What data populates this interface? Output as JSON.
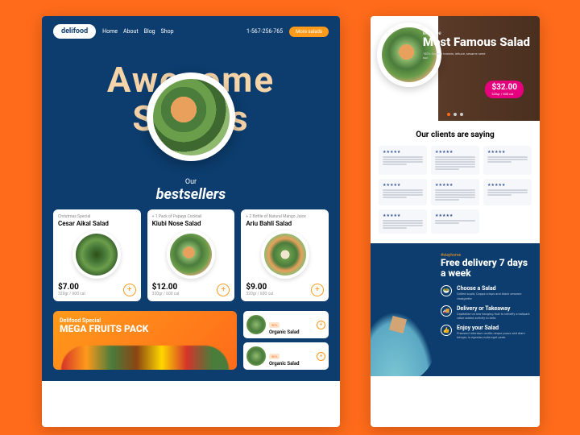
{
  "brand": "delifood",
  "nav": {
    "home": "Home",
    "about": "About",
    "blog": "Blog",
    "shop": "Shop"
  },
  "phone": "1-567-256-765",
  "cta": "More salads",
  "hero": {
    "line1": "Awesome",
    "line2": "Salads"
  },
  "best": {
    "our": "Our",
    "title": "bestsellers"
  },
  "cards": [
    {
      "tag": "Christmas Special",
      "title": "Cesar Aikal Salad",
      "price": "$7.00",
      "weight": "320gr / 600 cal"
    },
    {
      "tag": "+ 1 Pack of Papaya Cocktail",
      "title": "Kiubi Nose Salad",
      "price": "$12.00",
      "weight": "320gr / 600 cal"
    },
    {
      "tag": "+ 2 Bottle of Natural Mango Juice",
      "title": "Ariu Bahli Salad",
      "price": "$9.00",
      "weight": "320gr / 600 cal"
    }
  ],
  "mega": {
    "sub": "Delifood Special",
    "title": "MEGA FRUITS PACK"
  },
  "mini": {
    "badge": "50%",
    "title": "Organic Salad"
  },
  "famous": {
    "meet": "Meet the",
    "title": "Most Famous Salad",
    "desc": "100% Organic tomato, lettuce, sesame seed bun",
    "price": "$32.00",
    "weight": "320gr / 600 cal"
  },
  "reviews": {
    "title": "Our clients are saying",
    "stars": "★★★★★"
  },
  "delivery": {
    "tag": "#stayhome",
    "title": "Free delivery 7 days a week",
    "items": [
      {
        "title": "Choose a Salad",
        "desc": "Grilled squid, Cappa crisps and black sesame vinaigrette"
      },
      {
        "title": "Delivery or Takeaway",
        "desc": "Capitalize on low hanging fruit to identify a ballpark value added activity to beta"
      },
      {
        "title": "Enjoy your Salad",
        "desc": "Praesent interdum mollis neque purus sed diam integer, in egestas nulla eget pede."
      }
    ]
  }
}
